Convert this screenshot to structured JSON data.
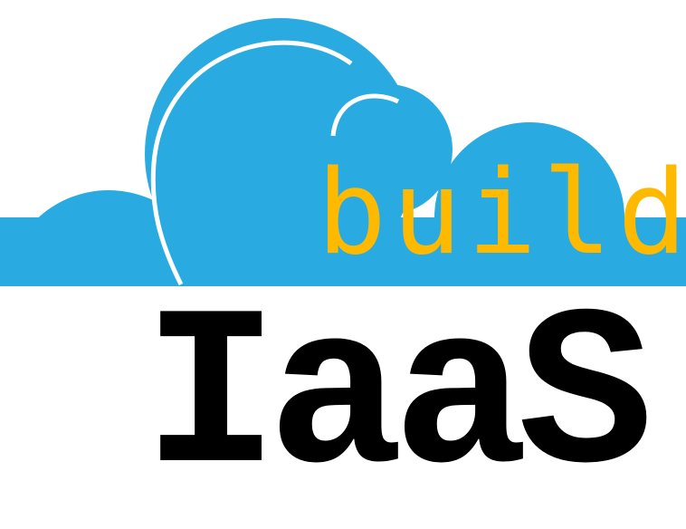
{
  "logo": {
    "tagline": "build",
    "wordmark": "IaaS",
    "colors": {
      "cloud": "#29ABE2",
      "cloud_highlight": "#FFFFFF",
      "tagline": "#FFBA00",
      "wordmark": "#000000",
      "background": "#FFFFFF"
    }
  }
}
